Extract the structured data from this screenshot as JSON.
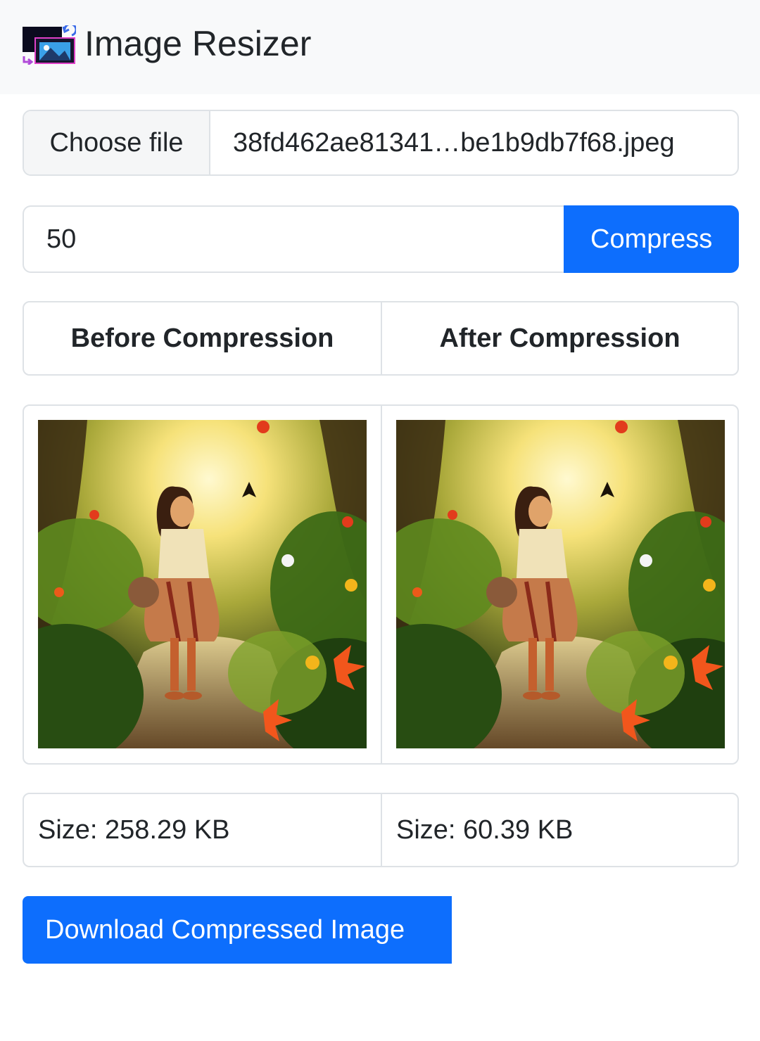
{
  "app": {
    "title": "Image Resizer",
    "logo_icon": "image-resize-icon"
  },
  "file_picker": {
    "button_label": "Choose file",
    "file_name": "38fd462ae81341…be1b9db7f68.jpeg"
  },
  "quality": {
    "value": "50",
    "compress_label": "Compress"
  },
  "comparison": {
    "before_header": "Before Compression",
    "after_header": "After Compression",
    "before_size": "Size: 258.29 KB",
    "after_size": "Size: 60.39 KB"
  },
  "download": {
    "label": "Download Compressed Image"
  },
  "colors": {
    "primary": "#0d6efd",
    "navbar_bg": "#f8f9fa",
    "border": "#dee2e6"
  }
}
